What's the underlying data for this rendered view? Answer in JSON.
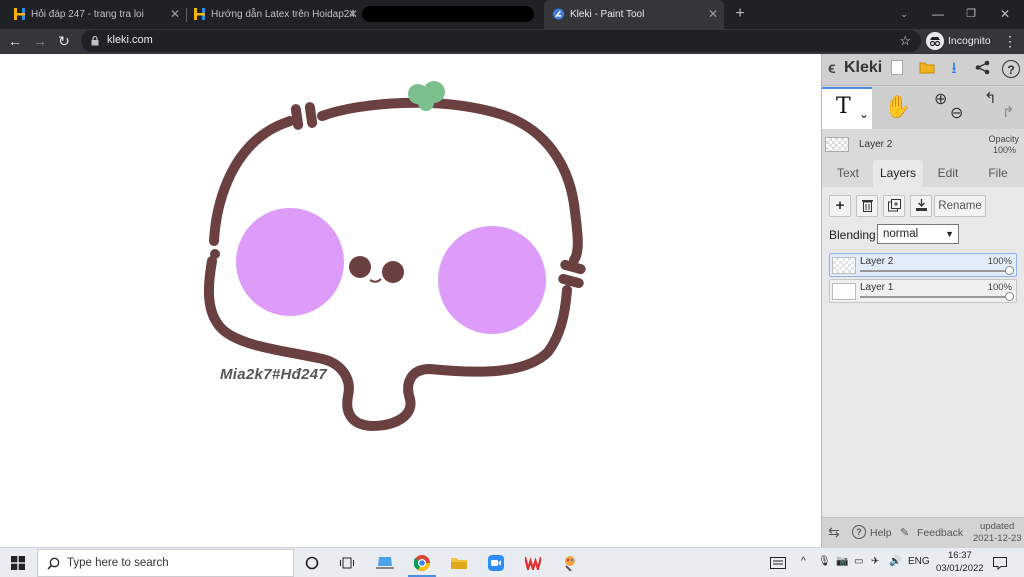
{
  "browser": {
    "tabs": [
      {
        "title": "Hỏi đáp 247 - trang tra loi",
        "active": false
      },
      {
        "title": "Hướng dẫn Latex trên Hoidap24",
        "active": false
      },
      {
        "title": "",
        "active": false
      },
      {
        "title": "Kleki - Paint Tool",
        "active": true
      }
    ],
    "new_tab_label": "+",
    "url": "kleki.com",
    "incognito_label": "Incognito"
  },
  "canvas": {
    "signature": "Mia2k7#Hđ247",
    "colors": {
      "outline": "#6b4040",
      "cheeks": "#dd9cf9",
      "sprout": "#7bbf8c"
    }
  },
  "kleki": {
    "logo": "Kleki",
    "tools": {
      "text_tool_glyph": "T",
      "dropdown_glyph": "⌄"
    },
    "current_layer": "Layer 2",
    "opacity_label": "Opacity",
    "opacity_value": "100%",
    "tabs": [
      "Text",
      "Layers",
      "Edit",
      "File"
    ],
    "active_tab": "Layers",
    "buttons": {
      "rename": "Rename"
    },
    "blending_label": "Blending",
    "blending_value": "normal",
    "layers": [
      {
        "name": "Layer 2",
        "opacity": "100%",
        "opacity_level": 1.0,
        "active": true
      },
      {
        "name": "Layer 1",
        "opacity": "100%",
        "opacity_level": 1.0,
        "active": false
      }
    ],
    "footer": {
      "help": "Help",
      "feedback": "Feedback",
      "updated_label": "updated",
      "updated_date": "2021-12-23"
    }
  },
  "taskbar": {
    "search_placeholder": "Type here to search",
    "language": "ENG",
    "time": "16:37",
    "date": "03/01/2022"
  }
}
